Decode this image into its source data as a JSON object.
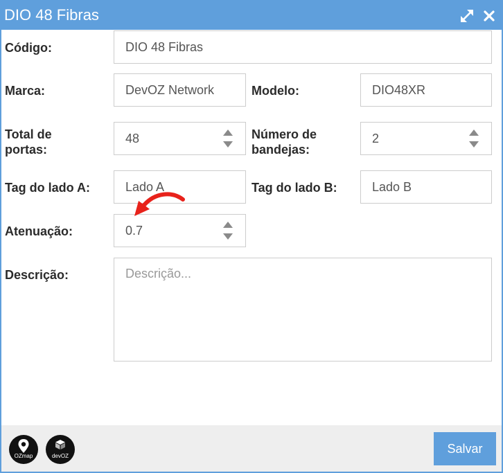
{
  "window": {
    "title": "DIO 48 Fibras",
    "maximize_icon": "expand-arrows-icon",
    "close_icon": "close-icon"
  },
  "form": {
    "codigo": {
      "label": "Código:",
      "value": "DIO 48 Fibras"
    },
    "marca": {
      "label": "Marca:",
      "value": "DevOZ Network"
    },
    "modelo": {
      "label": "Modelo:",
      "value": "DIO48XR"
    },
    "total_portas": {
      "label_line1": "Total de",
      "label_line2": "portas:",
      "value": "48"
    },
    "numero_bandejas": {
      "label_line1": "Número de",
      "label_line2": "bandejas:",
      "value": "2"
    },
    "tag_lado_a": {
      "label": "Tag do lado A:",
      "value": "Lado A"
    },
    "tag_lado_b": {
      "label": "Tag do lado B:",
      "value": "Lado B"
    },
    "atenuacao": {
      "label": "Atenuação:",
      "value": "0.7"
    },
    "descricao": {
      "label": "Descrição:",
      "value": "",
      "placeholder": "Descrição..."
    }
  },
  "footer": {
    "logos": [
      {
        "name": "ozmap-logo",
        "text": "OZmap"
      },
      {
        "name": "devoz-logo",
        "text": "devOZ"
      }
    ],
    "save_label": "Salvar"
  },
  "annotation": {
    "arrow_color": "#e8221b",
    "icon": "red-curved-arrow"
  },
  "colors": {
    "accent": "#5f9fdc",
    "border": "#cccccc",
    "footer_bg": "#eeeeee"
  }
}
